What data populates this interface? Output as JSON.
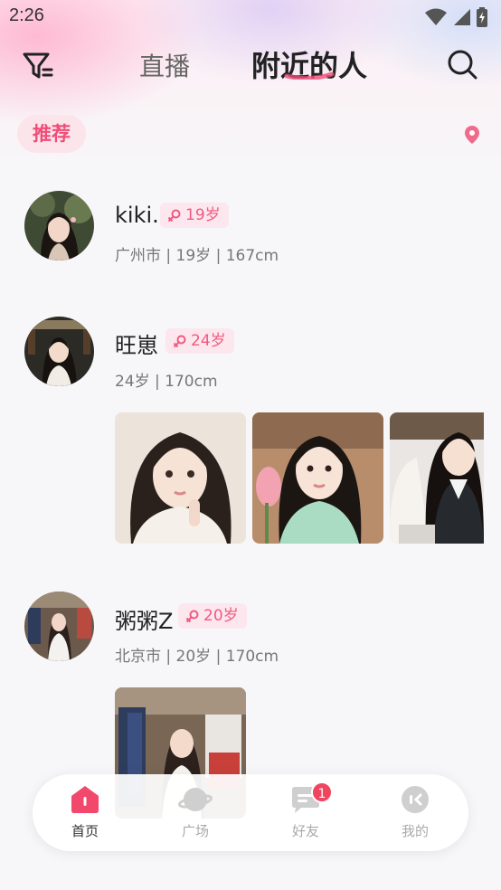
{
  "status_bar": {
    "time": "2:26"
  },
  "header": {
    "tabs": [
      {
        "label": "直播",
        "active": false
      },
      {
        "label": "附近的人",
        "active": true
      }
    ]
  },
  "filter": {
    "recommend_label": "推荐"
  },
  "users": [
    {
      "name": "kiki.",
      "age_badge": "19岁",
      "meta": "广州市 | 19岁 | 167cm",
      "photos": 0
    },
    {
      "name": "旺崽",
      "age_badge": "24岁",
      "meta": "24岁 | 170cm",
      "photos": 3
    },
    {
      "name": "粥粥Z",
      "age_badge": "20岁",
      "meta": "北京市 | 20岁 | 170cm",
      "photos": 1
    }
  ],
  "tabbar": {
    "items": [
      {
        "label": "首页",
        "icon": "home-icon",
        "active": true
      },
      {
        "label": "广场",
        "icon": "planet-icon",
        "active": false
      },
      {
        "label": "好友",
        "icon": "chat-icon",
        "active": false,
        "badge": "1"
      },
      {
        "label": "我的",
        "icon": "profile-icon",
        "active": false
      }
    ]
  },
  "colors": {
    "accent": "#ef4d77",
    "badge_bg": "#fde7ee",
    "notification": "#f0455f"
  }
}
